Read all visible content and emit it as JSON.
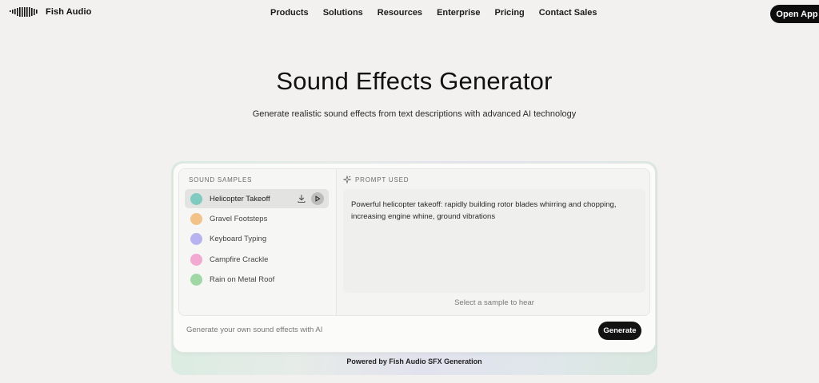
{
  "nav": {
    "brand": "Fish Audio",
    "menu": [
      "Products",
      "Solutions",
      "Resources",
      "Enterprise",
      "Pricing",
      "Contact Sales"
    ],
    "open_app": "Open App"
  },
  "hero": {
    "title": "Sound Effects Generator",
    "subtitle": "Generate realistic sound effects from text descriptions with advanced AI technology"
  },
  "samples": {
    "label": "SOUND SAMPLES",
    "items": [
      {
        "label": "Helicopter Takeoff",
        "color": "#7fcbc0",
        "active": true
      },
      {
        "label": "Gravel Footsteps",
        "color": "#f2c287",
        "active": false
      },
      {
        "label": "Keyboard Typing",
        "color": "#b7b3f0",
        "active": false
      },
      {
        "label": "Campfire Crackle",
        "color": "#f2a9d2",
        "active": false
      },
      {
        "label": "Rain on Metal Roof",
        "color": "#9fd8a5",
        "active": false
      }
    ]
  },
  "prompt": {
    "label": "PROMPT USED",
    "text": "Powerful helicopter takeoff: rapidly building rotor blades whirring and chopping, increasing engine whine, ground vibrations",
    "hint": "Select a sample to hear"
  },
  "generate": {
    "placeholder": "Generate your own sound effects with AI",
    "button": "Generate"
  },
  "footer": {
    "powered": "Powered by Fish Audio SFX Generation"
  }
}
